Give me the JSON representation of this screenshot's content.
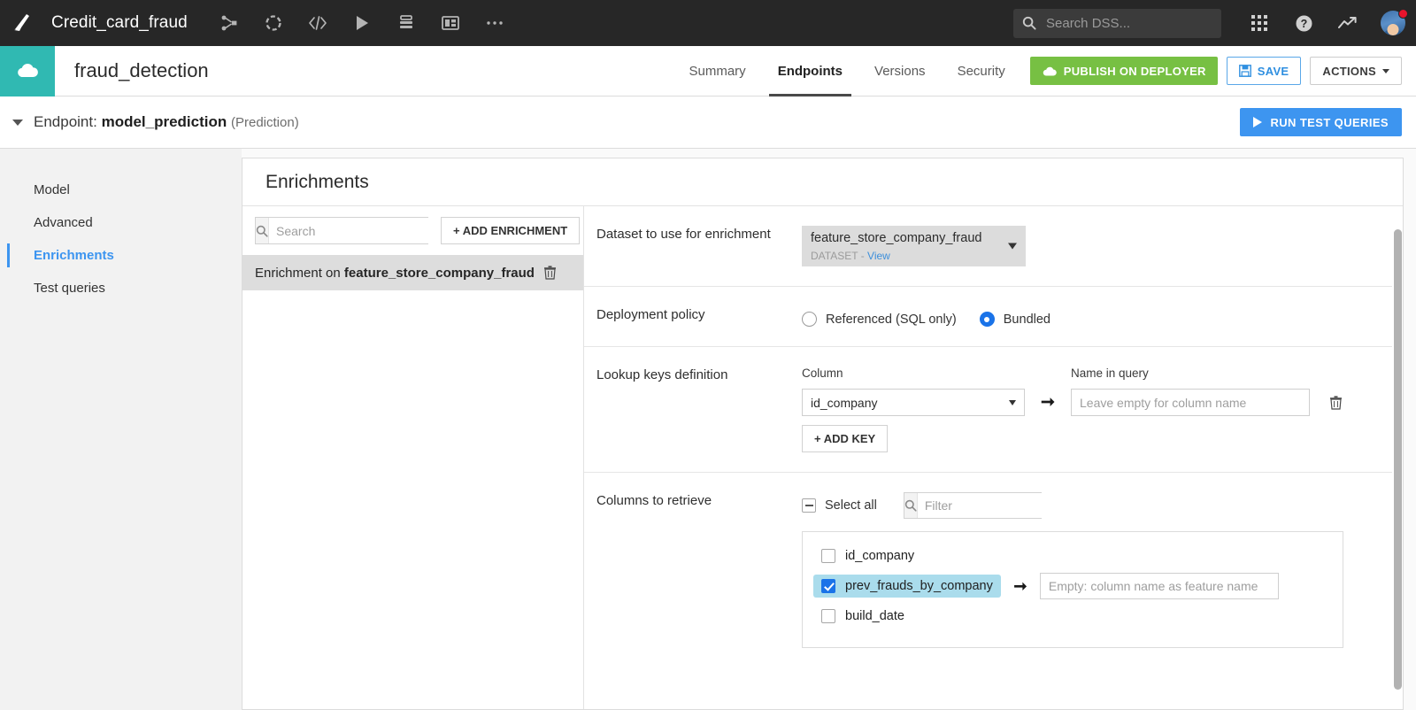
{
  "topbar": {
    "logo_icon": "dataiku-logo-icon",
    "project_name": "Credit_card_fraud",
    "icons": [
      {
        "name": "flow-icon",
        "title": "Flow"
      },
      {
        "name": "lab-icon",
        "title": "Lab"
      },
      {
        "name": "code-icon",
        "title": "Code"
      },
      {
        "name": "jobs-play-icon",
        "title": "Jobs"
      },
      {
        "name": "automation-icon",
        "title": "Automation"
      },
      {
        "name": "dashboard-icon",
        "title": "Dashboards"
      },
      {
        "name": "more-ellipsis-icon",
        "title": "More"
      }
    ],
    "search_placeholder": "Search DSS...",
    "search_value": "",
    "search_icon": "search-icon",
    "apps_icon": "apps-grid-icon",
    "help_icon": "help-circle-icon",
    "activity_icon": "trending-up-icon",
    "avatar_icon": "user-avatar",
    "avatar_badge": true
  },
  "projectbar": {
    "cloud_icon": "cloud-icon",
    "title": "fraud_detection",
    "tabs": [
      {
        "label": "Summary",
        "active": false
      },
      {
        "label": "Endpoints",
        "active": true
      },
      {
        "label": "Versions",
        "active": false
      },
      {
        "label": "Security",
        "active": false
      }
    ],
    "publish_label": "PUBLISH ON DEPLOYER",
    "publish_icon": "cloud-icon",
    "publish_color": "#77c043",
    "save_label": "SAVE",
    "save_icon": "floppy-disk-icon",
    "save_color": "#2f8fe0",
    "actions_label": "ACTIONS",
    "actions_icon": "chevron-down-icon"
  },
  "endpointbar": {
    "collapse_icon": "triangle-down-icon",
    "prefix": "Endpoint:",
    "name": "model_prediction",
    "type": "(Prediction)",
    "run_test_label": "RUN TEST QUERIES",
    "run_test_icon": "play-icon",
    "run_test_color": "#3d95f0"
  },
  "sidebar": {
    "items": [
      {
        "label": "Model",
        "active": false
      },
      {
        "label": "Advanced",
        "active": false
      },
      {
        "label": "Enrichments",
        "active": true
      },
      {
        "label": "Test queries",
        "active": false
      }
    ],
    "accent_color": "#3d95f0"
  },
  "card": {
    "title": "Enrichments"
  },
  "enrichment_list": {
    "search_placeholder": "Search",
    "search_value": "",
    "search_icon": "search-icon",
    "add_label": "+ ADD ENRICHMENT",
    "rows": [
      {
        "prefix": "Enrichment on ",
        "dataset": "feature_store_company_fraud",
        "delete_icon": "trash-icon",
        "selected": true
      }
    ]
  },
  "detail": {
    "dataset_section": {
      "label": "Dataset to use for enrichment",
      "value": "feature_store_company_fraud",
      "sub_type": "DATASET",
      "sub_sep": "-",
      "sub_link": "View",
      "caret_icon": "chevron-down-icon"
    },
    "deployment_section": {
      "label": "Deployment policy",
      "options": [
        {
          "label": "Referenced (SQL only)",
          "selected": false
        },
        {
          "label": "Bundled",
          "selected": true
        }
      ],
      "accent_color": "#1a73e8"
    },
    "lookup_section": {
      "label": "Lookup keys definition",
      "col_header": "Column",
      "name_header": "Name in query",
      "keys": [
        {
          "column": "id_company",
          "name_placeholder": "Leave empty for column name",
          "name_value": "",
          "arrow_icon": "arrow-right-icon",
          "delete_icon": "trash-icon"
        }
      ],
      "add_key_label": "+ ADD KEY"
    },
    "columns_section": {
      "label": "Columns to retrieve",
      "select_all_label": "Select all",
      "select_all_state": "indeterminate",
      "filter_placeholder": "Filter",
      "filter_value": "",
      "filter_icon": "search-icon",
      "columns": [
        {
          "name": "id_company",
          "checked": false,
          "has_alias": false
        },
        {
          "name": "prev_frauds_by_company",
          "checked": true,
          "has_alias": true,
          "alias_placeholder": "Empty: column name as feature name",
          "alias_value": "",
          "arrow_icon": "arrow-right-icon",
          "highlight_color": "#aadcec"
        },
        {
          "name": "build_date",
          "checked": false,
          "has_alias": false
        }
      ]
    },
    "scrollbar": "vertical-scrollbar"
  }
}
